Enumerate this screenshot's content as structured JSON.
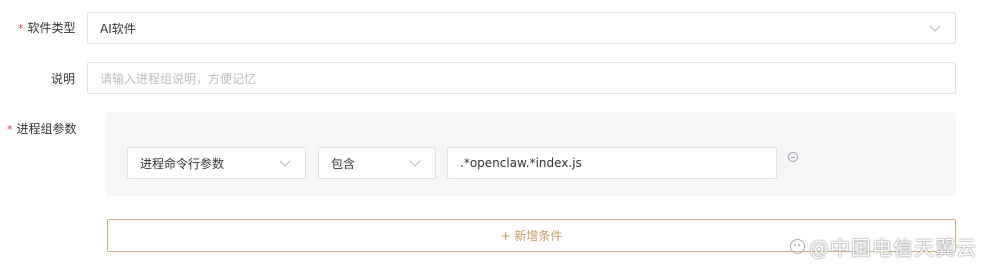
{
  "form": {
    "software_type": {
      "label": "软件类型",
      "required_mark": "*",
      "value": "AI软件",
      "icon": "chevron-down-icon"
    },
    "description": {
      "label": "说明",
      "placeholder": "请输入进程组说明，方便记忆",
      "value": ""
    },
    "process_group_params": {
      "label": "进程组参数",
      "required_mark": "*",
      "conditions": [
        {
          "field": "进程命令行参数",
          "operator": "包含",
          "value": ".*openclaw.*index.js"
        }
      ],
      "remove_icon": "minus-circle-icon"
    },
    "add_condition_label": "+ 新增条件"
  },
  "watermark": {
    "text": "@中国电信天翼云"
  },
  "colors": {
    "required": "#e23a3a",
    "accent": "#c49a5e",
    "accent_border": "#cfae7c",
    "panel_background": "#f6f7f9",
    "border": "#e0e0e0",
    "placeholder": "#b9bcc2"
  }
}
